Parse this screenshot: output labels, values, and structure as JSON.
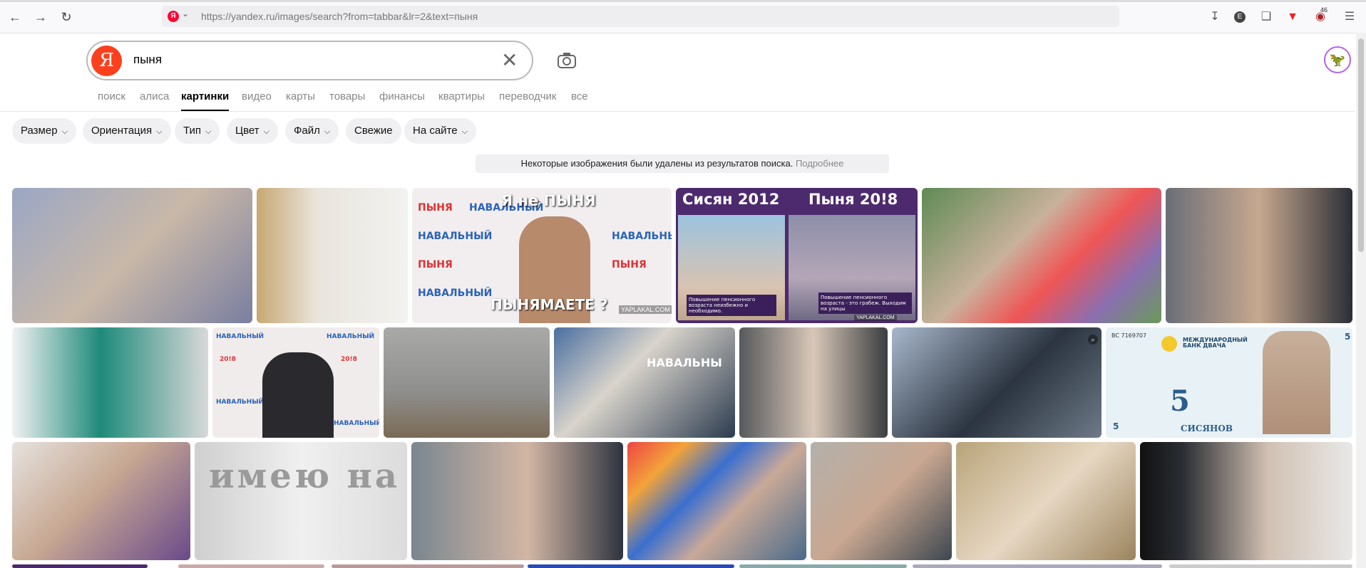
{
  "browser": {
    "url_host": "https://yandex.ru",
    "url_path": "/images/search?from=tabbar&lr=2&text=пыня",
    "ya_badge": "Я",
    "profile_badge": "E",
    "ext_count": "46"
  },
  "search": {
    "logo": "Я",
    "query": "пыня",
    "clear_icon": "close-icon",
    "camera_icon": "camera-icon"
  },
  "tabs": [
    {
      "label": "поиск"
    },
    {
      "label": "алиса"
    },
    {
      "label": "картинки",
      "active": true
    },
    {
      "label": "видео"
    },
    {
      "label": "карты"
    },
    {
      "label": "товары"
    },
    {
      "label": "финансы"
    },
    {
      "label": "квартиры"
    },
    {
      "label": "переводчик"
    },
    {
      "label": "все"
    }
  ],
  "filters": [
    {
      "label": "Размер",
      "dropdown": true
    },
    {
      "label": "Ориентация",
      "dropdown": true
    },
    {
      "label": "Тип",
      "dropdown": true
    },
    {
      "label": "Цвет",
      "dropdown": true
    },
    {
      "label": "Файл",
      "dropdown": true
    },
    {
      "label": "Свежие",
      "dropdown": false
    },
    {
      "label": "На сайте",
      "dropdown": true
    }
  ],
  "notice": {
    "text": "Некоторые изображения были удалены из результатов поиска.",
    "link": "Подробнее"
  },
  "image_texts": {
    "t3_top": "Я не ПЫНЯ",
    "t3_bottom": "ПЫНЯМАЕТЕ ?",
    "t3_wm": "YAPLAKAL.COM",
    "t3_bg_a": "НАВАЛЬНЫЙ",
    "t3_bg_b": "ПЫНЯ",
    "t4_left_title": "Сисян 2012",
    "t4_right_title": "Пыня 20!8",
    "t4_left_cap": "Повышение пенсионного возраста неизбежно и необходимо.",
    "t4_right_cap": "Повышение пенсионного возраста - это грабеж. Выходим на улицы",
    "t4_wm": "YAPLAKAL.COM",
    "t8_bg_a": "НАВАЛЬНЫЙ",
    "t8_bg_b": "20!8",
    "t7_bg": "НАВАЛЬ",
    "t10_bg": "НАВАЛЬНЫ",
    "t13_serial": "BC 7169707",
    "t13_bank": "МЕЖДУНАРОДНЫЙ БАНК ДВАЧА",
    "t13_denom": "5",
    "t13_name": "СИСЯНОВ",
    "t15_bg": "имею на сво"
  },
  "colors": {
    "yandex_red": "#fc3f1d",
    "chip_bg": "#f0f0f2",
    "purple_banner": "#4d2a6e"
  }
}
